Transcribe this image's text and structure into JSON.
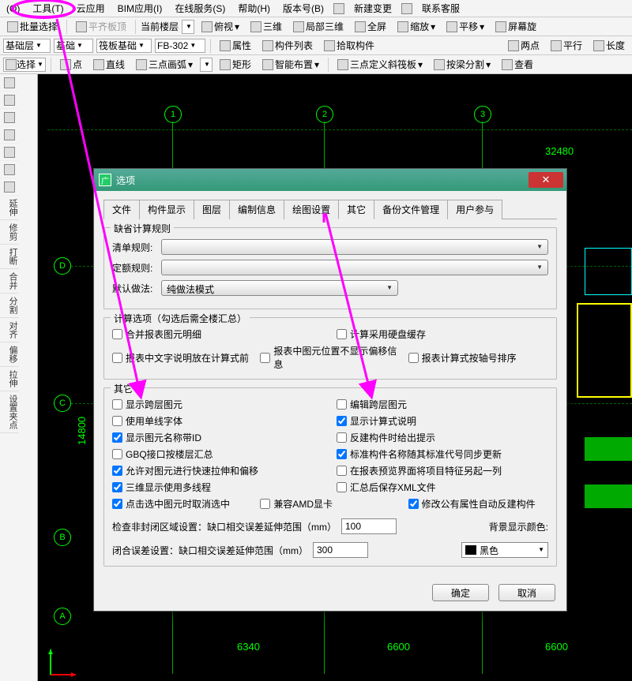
{
  "menu": {
    "items": [
      "(O)",
      "工具(T)",
      "云应用",
      "BIM应用(I)",
      "在线服务(S)",
      "帮助(H)",
      "版本号(B)"
    ],
    "extra1": "新建变更",
    "extra2": "联系客服"
  },
  "toolbar1": {
    "batch": "批量选择",
    "flat": "平齐板顶",
    "floor_label": "当前楼层",
    "view_top": "俯视",
    "view_3d": "三维",
    "view_local3d": "局部三维",
    "fullscreen": "全屏",
    "zoom": "缩放",
    "pan": "平移",
    "screen_rot": "屏幕旋"
  },
  "toolbar2": {
    "dd1": "基础层",
    "dd2": "基础",
    "dd3": "筏板基础",
    "dd4": "FB-302",
    "attr": "属性",
    "list": "构件列表",
    "pick": "拾取构件",
    "two_pt": "两点",
    "parallel": "平行",
    "length": "长度"
  },
  "toolbar3": {
    "select": "选择",
    "point": "点",
    "line": "直线",
    "arc": "三点画弧",
    "rect": "矩形",
    "smart": "智能布置",
    "slope": "三点定义斜筏板",
    "beam_split": "按梁分割",
    "view": "查看"
  },
  "side": {
    "labels": [
      "延伸",
      "修剪",
      "打断",
      "合并",
      "分割",
      "对齐",
      "偏移",
      "拉伸",
      "设置夹点"
    ]
  },
  "grid": {
    "col_bubbles": [
      "1",
      "2",
      "3"
    ],
    "row_bubbles": [
      "D",
      "C",
      "B",
      "A"
    ],
    "dim_top": "32480",
    "dim_left": "14800",
    "dims_bottom": [
      "6340",
      "6600",
      "6600"
    ]
  },
  "dialog": {
    "title": "选项",
    "tabs": [
      "文件",
      "构件显示",
      "图层",
      "编制信息",
      "绘图设置",
      "其它",
      "备份文件管理",
      "用户参与"
    ],
    "active_tab": 5,
    "group1": {
      "legend": "缺省计算规则",
      "row1_label": "清单规则:",
      "row2_label": "定额规则:",
      "row3_label": "默认做法:",
      "row3_value": "纯做法模式"
    },
    "group2": {
      "legend": "计算选项（勾选后需全楼汇总）",
      "c1": "合并报表图元明细",
      "c2": "计算采用硬盘缓存",
      "c3": "报表中文字说明放在计算式前",
      "c4": "报表中图元位置不显示偏移信息",
      "c5": "报表计算式按轴号排序"
    },
    "group3": {
      "legend": "其它",
      "l1": "显示跨层图元",
      "l2": "使用单线字体",
      "l3": "显示图元名称带ID",
      "l4": "GBQ接口按楼层汇总",
      "l5": "允许对图元进行快速拉伸和偏移",
      "l6": "三维显示使用多线程",
      "l7": "点击选中图元时取消选中",
      "r1": "编辑跨层图元",
      "r2": "显示计算式说明",
      "r3": "反建构件时给出提示",
      "r4": "标准构件名称随其标准代号同步更新",
      "r5": "在报表预览界面将项目特征另起一列",
      "r6": "汇总后保存XML文件",
      "m1": "兼容AMD显卡",
      "m2": "修改公有属性自动反建构件",
      "row_a_label": "检查非封闭区域设置：缺口相交误差延伸范围（mm）",
      "row_a_val": "100",
      "row_b_label": "闭合误差设置：缺口相交误差延伸范围（mm）",
      "row_b_val": "300",
      "bgcolor_label": "背景显示颜色:",
      "bgcolor_val": "黑色"
    },
    "ok": "确定",
    "cancel": "取消"
  }
}
